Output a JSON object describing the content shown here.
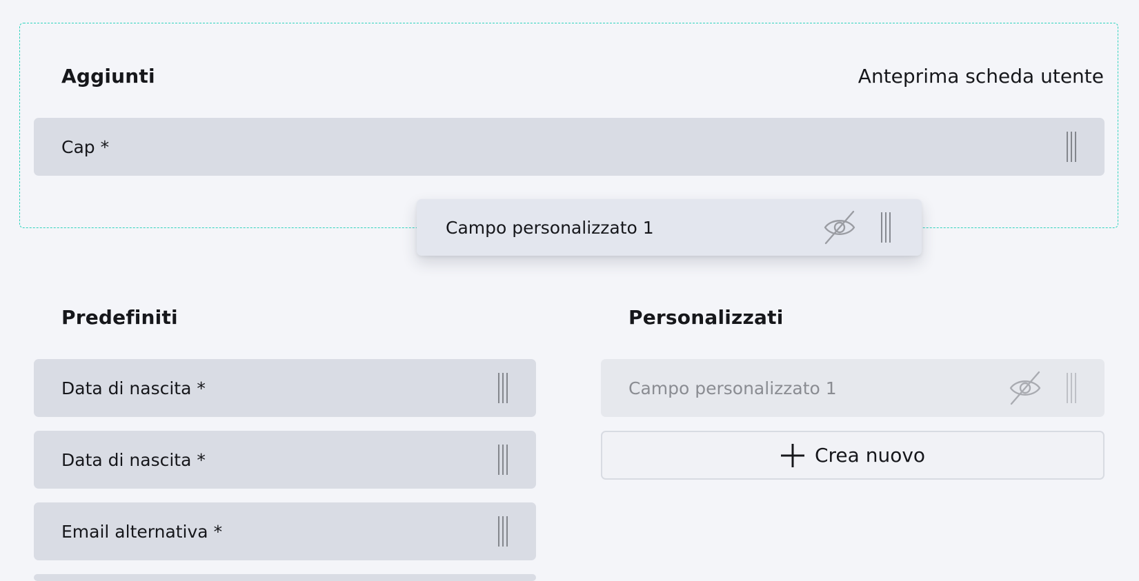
{
  "added_section": {
    "title": "Aggiunti",
    "preview_link": "Anteprima scheda utente",
    "fields": [
      {
        "label": "Cap *"
      }
    ]
  },
  "dragging_item": {
    "label": "Campo personalizzato 1",
    "visibility_icon": "eye-off-icon",
    "handle_icon": "drag-handle-icon"
  },
  "predefined_section": {
    "title": "Predefiniti",
    "fields": [
      {
        "label": "Data di nascita *"
      },
      {
        "label": "Data di nascita *"
      },
      {
        "label": "Email alternativa *"
      }
    ]
  },
  "custom_section": {
    "title": "Personalizzati",
    "fields": [
      {
        "label": "Campo personalizzato 1",
        "hidden": true
      }
    ],
    "create_button": "Crea nuovo"
  },
  "colors": {
    "dropzone_border": "#2ed3bd",
    "row_background": "#d9dce4",
    "page_background": "#f4f5f9",
    "muted_text": "#8a8c92"
  }
}
